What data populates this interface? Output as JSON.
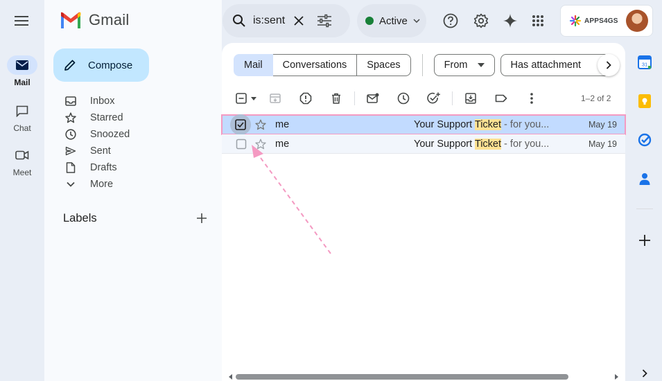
{
  "app": {
    "name": "Gmail"
  },
  "rail": {
    "items": [
      {
        "label": "Mail",
        "icon": "mail-icon",
        "active": true
      },
      {
        "label": "Chat",
        "icon": "chat-icon",
        "active": false
      },
      {
        "label": "Meet",
        "icon": "meet-icon",
        "active": false
      }
    ]
  },
  "nav": {
    "compose_label": "Compose",
    "items": [
      {
        "label": "Inbox",
        "icon": "inbox-icon"
      },
      {
        "label": "Starred",
        "icon": "star-icon"
      },
      {
        "label": "Snoozed",
        "icon": "clock-icon"
      },
      {
        "label": "Sent",
        "icon": "send-icon"
      },
      {
        "label": "Drafts",
        "icon": "draft-icon"
      },
      {
        "label": "More",
        "icon": "chevron-down-icon"
      }
    ],
    "labels_heading": "Labels"
  },
  "search": {
    "value": "is:sent"
  },
  "status": {
    "label": "Active",
    "color": "#188038"
  },
  "account": {
    "brand": "APPS4GS"
  },
  "filters": {
    "segments": [
      "Mail",
      "Conversations",
      "Spaces"
    ],
    "from_label": "From",
    "attachment_label": "Has attachment"
  },
  "toolbar": {
    "count": "1–2 of 2"
  },
  "emails": [
    {
      "sender": "me",
      "subject_pre": "Your Support ",
      "highlight": "Ticket",
      "snippet": " - for you...",
      "date": "May 19",
      "selected": true
    },
    {
      "sender": "me",
      "subject_pre": "Your Support ",
      "highlight": "Ticket",
      "snippet": " - for you...",
      "date": "May 19",
      "selected": false
    }
  ],
  "colors": {
    "accent": "#0b57d0",
    "selected_row": "#c2dbff",
    "highlight": "#fde293",
    "annotation": "#f49ac2"
  }
}
